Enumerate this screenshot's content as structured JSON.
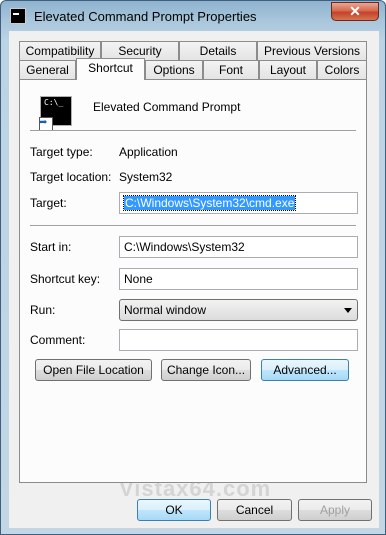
{
  "window": {
    "title": "Elevated Command Prompt Properties",
    "close_glyph": "✕"
  },
  "tabs_row1": [
    "Compatibility",
    "Security",
    "Details",
    "Previous Versions"
  ],
  "tabs_row2": [
    "General",
    "Shortcut",
    "Options",
    "Font",
    "Layout",
    "Colors"
  ],
  "active_tab": "Shortcut",
  "shortcut": {
    "name": "Elevated Command Prompt",
    "icon_text": "C:\\_",
    "target_type_label": "Target type:",
    "target_type_value": "Application",
    "target_location_label": "Target location:",
    "target_location_value": "System32",
    "target_label": "Target:",
    "target_value": "C:\\Windows\\System32\\cmd.exe",
    "start_in_label": "Start in:",
    "start_in_value": "C:\\Windows\\System32",
    "shortcut_key_label": "Shortcut key:",
    "shortcut_key_value": "None",
    "run_label": "Run:",
    "run_value": "Normal window",
    "comment_label": "Comment:",
    "comment_value": ""
  },
  "buttons": {
    "open_file_location": "Open File Location",
    "change_icon": "Change Icon...",
    "advanced": "Advanced...",
    "ok": "OK",
    "cancel": "Cancel",
    "apply": "Apply"
  },
  "watermark": "Vistax64.com",
  "colors": {
    "highlight": "#cc1f2f",
    "selection": "#3399ff"
  }
}
